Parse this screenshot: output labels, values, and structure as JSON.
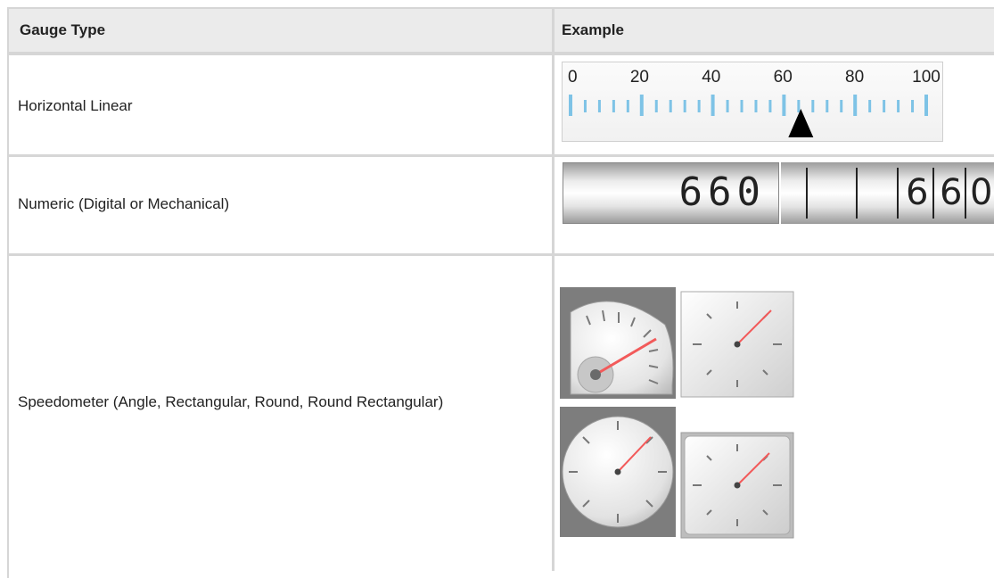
{
  "table": {
    "headers": {
      "type": "Gauge Type",
      "example": "Example"
    },
    "rows": [
      {
        "type": "Horizontal Linear"
      },
      {
        "type": "Numeric (Digital or Mechanical)"
      },
      {
        "type": "Speedometer (Angle, Rectangular, Round, Round Rectangular)"
      }
    ]
  },
  "linear_gauge": {
    "scale_labels": [
      "0",
      "20",
      "40",
      "60",
      "80",
      "100"
    ],
    "pointer_value": 65,
    "tick_color": "#7ec3e6"
  },
  "numeric_gauge": {
    "digital_value": "660",
    "mechanical_digits": [
      "6",
      "6",
      "0"
    ]
  },
  "speedometer": {
    "needle_color": "#f25a5a",
    "dials": [
      "angle",
      "rectangular",
      "round",
      "round-rectangular"
    ]
  }
}
